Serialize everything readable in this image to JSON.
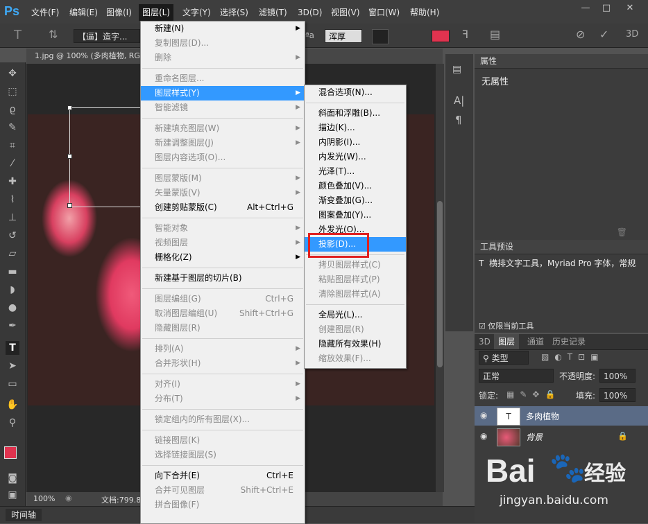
{
  "app": {
    "logo": "Ps"
  },
  "menubar": {
    "items": [
      "文件(F)",
      "编辑(E)",
      "图像(I)",
      "图层(L)",
      "文字(Y)",
      "选择(S)",
      "滤镜(T)",
      "3D(D)",
      "视图(V)",
      "窗口(W)",
      "帮助(H)"
    ],
    "active_index": 3,
    "window_controls": [
      "—",
      "□",
      "✕"
    ]
  },
  "options_bar": {
    "tool_icon": "type-tool-icon",
    "font_name": "【逼】造字...",
    "aa_label": "ªa",
    "antialias": "浑厚",
    "color_swatch": "#e0334f",
    "threed_label": "3D"
  },
  "document": {
    "tab_title": "1.jpg @ 100% (多肉植物, RG",
    "zoom": "100%",
    "doc_info": "文档:799.8"
  },
  "timeline": {
    "label": "时间轴"
  },
  "layer_menu": {
    "items": [
      {
        "label": "新建(N)",
        "shortcut": "",
        "submenu": true,
        "disabled": false
      },
      {
        "label": "复制图层(D)...",
        "shortcut": "",
        "submenu": false,
        "disabled": true
      },
      {
        "label": "删除",
        "shortcut": "",
        "submenu": true,
        "disabled": true
      },
      {
        "sep": true
      },
      {
        "label": "重命名图层...",
        "shortcut": "",
        "submenu": false,
        "disabled": true
      },
      {
        "label": "图层样式(Y)",
        "shortcut": "",
        "submenu": true,
        "disabled": false,
        "highlight": true
      },
      {
        "label": "智能滤镜",
        "shortcut": "",
        "submenu": true,
        "disabled": true
      },
      {
        "sep": true
      },
      {
        "label": "新建填充图层(W)",
        "shortcut": "",
        "submenu": true,
        "disabled": true
      },
      {
        "label": "新建调整图层(J)",
        "shortcut": "",
        "submenu": true,
        "disabled": true
      },
      {
        "label": "图层内容选项(O)...",
        "shortcut": "",
        "submenu": false,
        "disabled": true
      },
      {
        "sep": true
      },
      {
        "label": "图层蒙版(M)",
        "shortcut": "",
        "submenu": true,
        "disabled": true
      },
      {
        "label": "矢量蒙版(V)",
        "shortcut": "",
        "submenu": true,
        "disabled": true
      },
      {
        "label": "创建剪贴蒙版(C)",
        "shortcut": "Alt+Ctrl+G",
        "submenu": false,
        "disabled": false
      },
      {
        "sep": true
      },
      {
        "label": "智能对象",
        "shortcut": "",
        "submenu": true,
        "disabled": true
      },
      {
        "label": "视频图层",
        "shortcut": "",
        "submenu": true,
        "disabled": true
      },
      {
        "label": "栅格化(Z)",
        "shortcut": "",
        "submenu": true,
        "disabled": false
      },
      {
        "sep": true
      },
      {
        "label": "新建基于图层的切片(B)",
        "shortcut": "",
        "submenu": false,
        "disabled": false
      },
      {
        "sep": true
      },
      {
        "label": "图层编组(G)",
        "shortcut": "Ctrl+G",
        "submenu": false,
        "disabled": true
      },
      {
        "label": "取消图层编组(U)",
        "shortcut": "Shift+Ctrl+G",
        "submenu": false,
        "disabled": true
      },
      {
        "label": "隐藏图层(R)",
        "shortcut": "",
        "submenu": false,
        "disabled": true
      },
      {
        "sep": true
      },
      {
        "label": "排列(A)",
        "shortcut": "",
        "submenu": true,
        "disabled": true
      },
      {
        "label": "合并形状(H)",
        "shortcut": "",
        "submenu": true,
        "disabled": true
      },
      {
        "sep": true
      },
      {
        "label": "对齐(I)",
        "shortcut": "",
        "submenu": true,
        "disabled": true
      },
      {
        "label": "分布(T)",
        "shortcut": "",
        "submenu": true,
        "disabled": true
      },
      {
        "sep": true
      },
      {
        "label": "锁定组内的所有图层(X)...",
        "shortcut": "",
        "submenu": false,
        "disabled": true
      },
      {
        "sep": true
      },
      {
        "label": "链接图层(K)",
        "shortcut": "",
        "submenu": false,
        "disabled": true
      },
      {
        "label": "选择链接图层(S)",
        "shortcut": "",
        "submenu": false,
        "disabled": true
      },
      {
        "sep": true
      },
      {
        "label": "向下合并(E)",
        "shortcut": "Ctrl+E",
        "submenu": false,
        "disabled": false
      },
      {
        "label": "合并可见图层",
        "shortcut": "Shift+Ctrl+E",
        "submenu": false,
        "disabled": true
      },
      {
        "label": "拼合图像(F)",
        "shortcut": "",
        "submenu": false,
        "disabled": true
      }
    ]
  },
  "style_submenu": {
    "items": [
      {
        "label": "混合选项(N)...",
        "disabled": false
      },
      {
        "sep": true
      },
      {
        "label": "斜面和浮雕(B)...",
        "disabled": false
      },
      {
        "label": "描边(K)...",
        "disabled": false
      },
      {
        "label": "内阴影(I)...",
        "disabled": false
      },
      {
        "label": "内发光(W)...",
        "disabled": false
      },
      {
        "label": "光泽(T)...",
        "disabled": false
      },
      {
        "label": "颜色叠加(V)...",
        "disabled": false
      },
      {
        "label": "渐变叠加(G)...",
        "disabled": false
      },
      {
        "label": "图案叠加(Y)...",
        "disabled": false
      },
      {
        "label": "外发光(O)...",
        "disabled": false
      },
      {
        "label": "投影(D)...",
        "disabled": false,
        "highlight": true
      },
      {
        "sep": true
      },
      {
        "label": "拷贝图层样式(C)",
        "disabled": true
      },
      {
        "label": "粘贴图层样式(P)",
        "disabled": true
      },
      {
        "label": "清除图层样式(A)",
        "disabled": true
      },
      {
        "sep": true
      },
      {
        "label": "全局光(L)...",
        "disabled": false
      },
      {
        "label": "创建图层(R)",
        "disabled": true
      },
      {
        "label": "隐藏所有效果(H)",
        "disabled": false
      },
      {
        "label": "缩放效果(F)...",
        "disabled": true
      }
    ]
  },
  "properties_panel": {
    "title": "属性",
    "content": "无属性"
  },
  "tool_presets_panel": {
    "title": "工具预设",
    "item": "横排文字工具，Myriad Pro 字体，常规",
    "checkbox_label": "仅限当前工具"
  },
  "layers_panel": {
    "tabs": [
      "3D",
      "图层",
      "通道",
      "历史记录"
    ],
    "active_tab": 1,
    "filter_kind": "类型",
    "blend_mode": "正常",
    "opacity_label": "不透明度:",
    "opacity_value": "100%",
    "lock_label": "锁定:",
    "fill_label": "填充:",
    "fill_value": "100%",
    "layers": [
      {
        "name": "多肉植物",
        "type": "text",
        "selected": true
      },
      {
        "name": "背景",
        "type": "image",
        "selected": false,
        "locked": true
      }
    ]
  },
  "watermark": {
    "brand": "Bai",
    "brand2": "经验",
    "url": "jingyan.baidu.com"
  }
}
